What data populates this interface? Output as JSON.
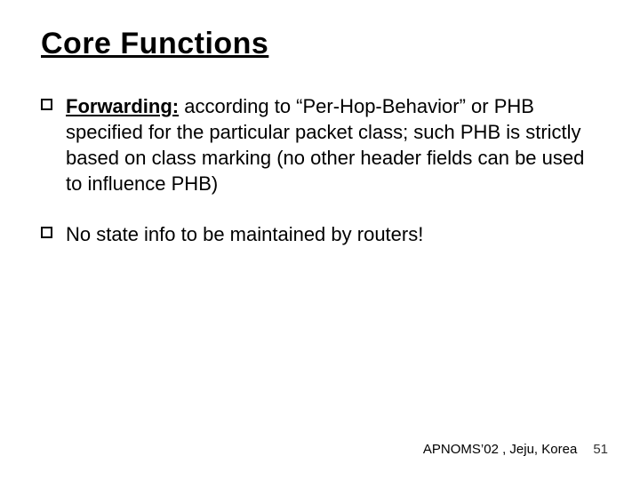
{
  "title": "Core Functions",
  "bullets": [
    {
      "lead": "Forwarding:",
      "rest": " according to “Per-Hop-Behavior” or PHB specified for the particular packet class; such PHB is strictly based on class marking (no other header fields can be used to influence PHB)"
    },
    {
      "lead": "",
      "rest": "No state info to be maintained by routers!"
    }
  ],
  "footer": {
    "location": "APNOMS’02 , Jeju, Korea",
    "page": "51"
  }
}
